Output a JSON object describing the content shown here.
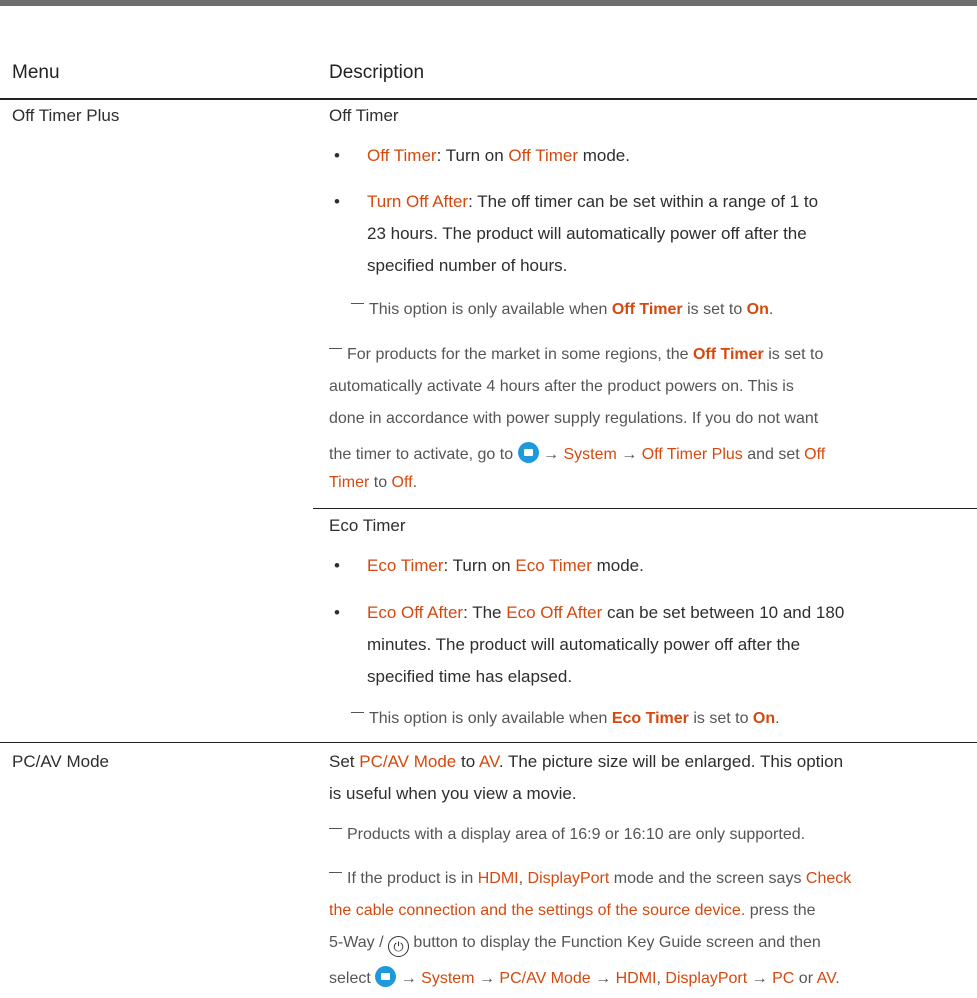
{
  "headers": {
    "menu": "Menu",
    "description": "Description"
  },
  "off_timer_plus": {
    "menu_label": "Off Timer Plus",
    "section_title": "Off Timer",
    "b1_label": "Off Timer",
    "b1_text1": ": Turn on ",
    "b1_term": "Off Timer",
    "b1_text2": " mode.",
    "b2_label": "Turn Off After",
    "b2_line1": ": The off timer can be set within a range of 1 to",
    "b2_line2": "23 hours. The product will automatically power off after the",
    "b2_line3": "specified number of hours.",
    "note1_pre": "This option is only available when ",
    "note1_term": "Off Timer",
    "note1_mid": " is set to ",
    "note1_val": "On",
    "note1_end": ".",
    "note2_line1_pre": "For products for the market in some regions, the ",
    "note2_term": "Off Timer",
    "note2_line1_post": " is set to",
    "note2_line2": "automatically activate 4 hours after the product powers on. This is",
    "note2_line3": "done in accordance with power supply regulations. If you do not want",
    "note2_line4_pre": "the timer to activate, go to ",
    "arrow": "→",
    "system": "System",
    "note2_path2": "Off Timer Plus",
    "note2_and_set": " and set ",
    "note2_off_1": "Off",
    "note2_timer": "Timer",
    "note2_to": " to ",
    "note2_off_val": "Off",
    "note2_end": ".",
    "eco_title": "Eco Timer",
    "e1_label": "Eco Timer",
    "e1_text1": ": Turn on ",
    "e1_term": "Eco Timer",
    "e1_text2": " mode.",
    "e2_label": "Eco Off After",
    "e2_text1": ": The ",
    "e2_term": "Eco Off After",
    "e2_line1_post": " can be set between 10 and 180",
    "e2_line2": "minutes. The product will automatically power off after the",
    "e2_line3": "specified time has elapsed.",
    "note3_pre": "This option is only available when ",
    "note3_term": "Eco Timer",
    "note3_mid": " is set to ",
    "note3_val": "On",
    "note3_end": "."
  },
  "pcav": {
    "menu_label": "PC/AV Mode",
    "l1_pre": "Set ",
    "l1_term": "PC/AV Mode",
    "l1_to": " to ",
    "l1_val": "AV",
    "l1_post": ". The picture size will be enlarged. This option",
    "l2": "is useful when you view a movie.",
    "n1": "Products with a display area of 16:9 or 16:10 are only supported.",
    "n2_pre": "If the product is in ",
    "hdmi": "HDMI",
    "comma": ", ",
    "displayport": "DisplayPort",
    "n2_mid": " mode and the screen says ",
    "n2_check": "Check",
    "n2_l2_term": "the cable connection and the settings of the source device.",
    "n2_l2_post": " press the",
    "n2_l3_pre": "5-Way / ",
    "power_glyph": "⏻",
    "n2_l3_post": " button to display the Function Key Guide screen and then",
    "n2_l4_pre": "select ",
    "pcav_mode": "PC/AV Mode",
    "pc": "PC",
    "or": " or ",
    "av": "AV",
    "period": "."
  }
}
